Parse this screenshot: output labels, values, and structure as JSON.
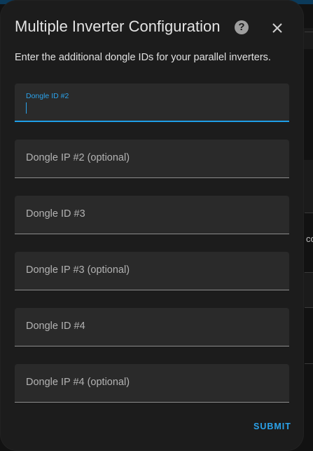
{
  "dialog": {
    "title": "Multiple Inverter Configuration",
    "help_glyph": "?",
    "subtitle": "Enter the additional dongle IDs for your parallel inverters.",
    "submit_label": "SUBMIT"
  },
  "fields": [
    {
      "label": "Dongle ID #2",
      "value": "",
      "focused": true
    },
    {
      "label": "Dongle IP #2 (optional)",
      "value": ""
    },
    {
      "label": "Dongle ID #3",
      "value": ""
    },
    {
      "label": "Dongle IP #3 (optional)",
      "value": ""
    },
    {
      "label": "Dongle ID #4",
      "value": ""
    },
    {
      "label": "Dongle IP #4 (optional)",
      "value": ""
    }
  ],
  "background": {
    "partial_text": "co"
  },
  "colors": {
    "accent": "#2ba2ea",
    "dialog_bg": "#1c1c1c",
    "field_bg": "#2a2a2a"
  },
  "icons": {
    "help": "help-circle-icon",
    "close": "close-icon"
  }
}
